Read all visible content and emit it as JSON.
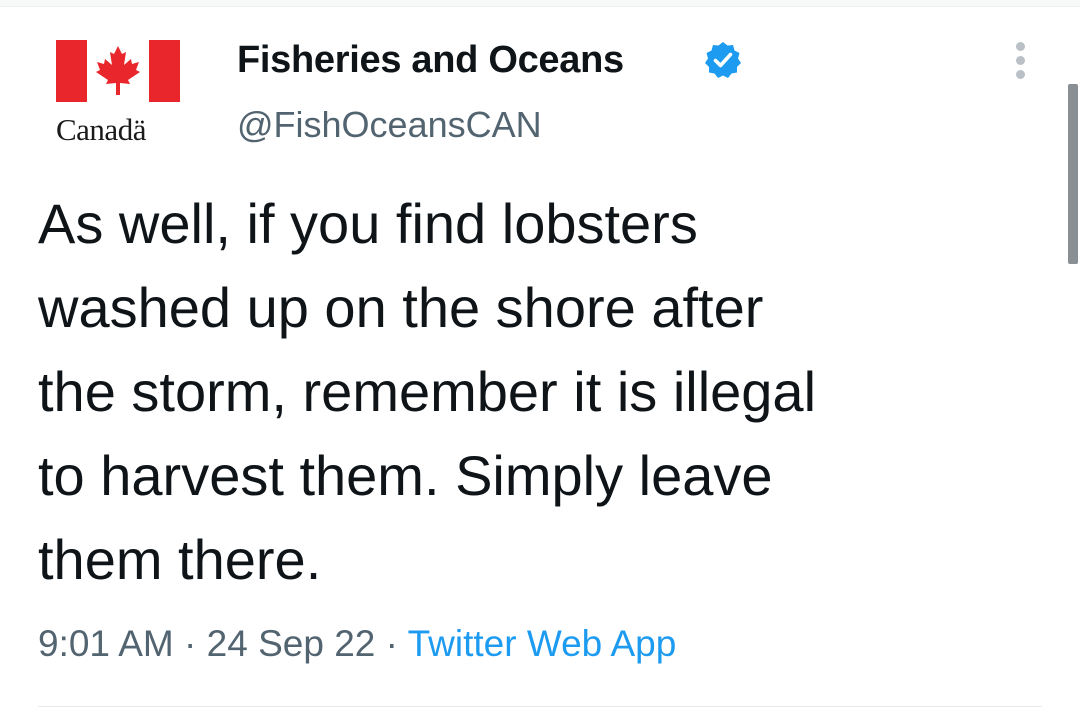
{
  "tweet": {
    "author": {
      "display_name": "Fisheries and Oceans",
      "handle": "@FishOceansCAN",
      "verified": true,
      "avatar_wordmark": "Canadä",
      "avatar_icon": "canada-flag-icon"
    },
    "text_lines": [
      "As well, if you find lobsters",
      "washed up on the shore after",
      "the storm, remember it is illegal",
      "to harvest them. Simply leave",
      "them there."
    ],
    "time": "9:01 AM",
    "separator": " · ",
    "date": "24 Sep 22",
    "source": "Twitter Web App"
  },
  "colors": {
    "text_primary": "#0f1419",
    "text_secondary": "#536471",
    "accent": "#1d9bf0",
    "flag_red": "#e8262b"
  },
  "icons": {
    "verified": "verified-badge-icon",
    "more": "more-options-icon"
  }
}
